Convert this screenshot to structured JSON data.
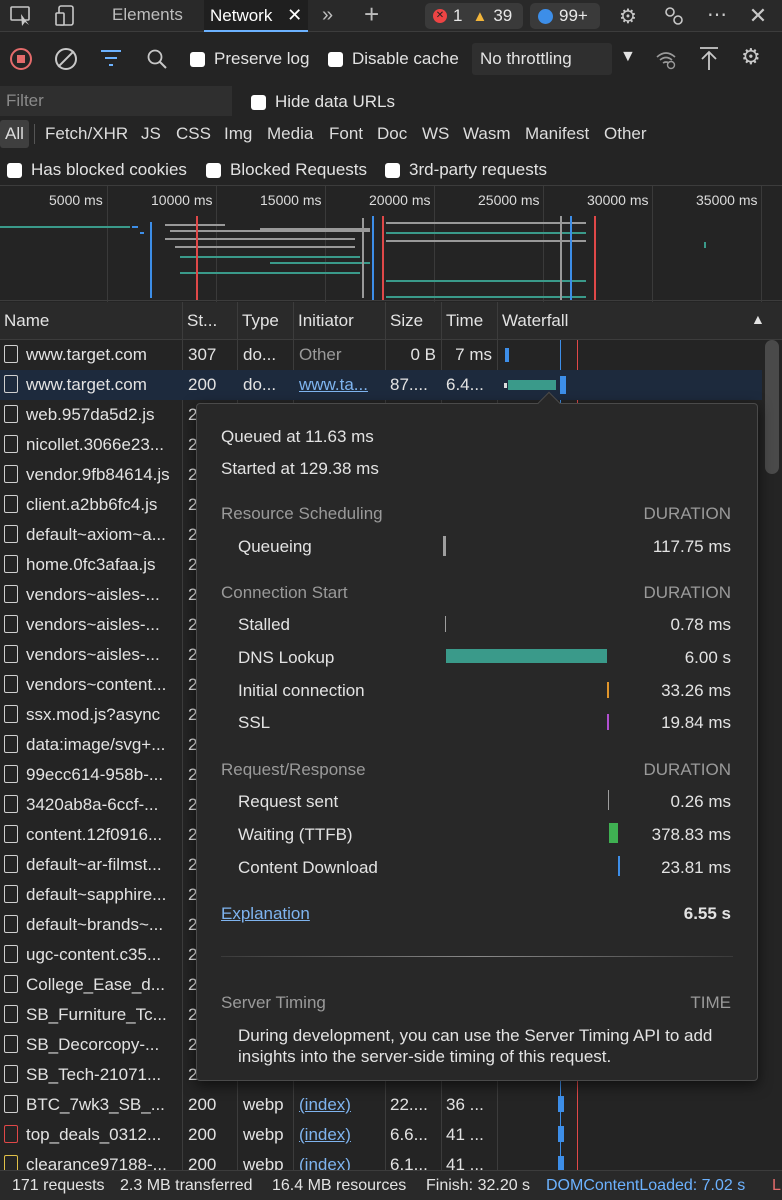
{
  "tabs": {
    "elements": "Elements",
    "network": "Network",
    "errors": "1",
    "warnings": "39",
    "messages": "99+"
  },
  "toolbar": {
    "preserve_log": "Preserve log",
    "disable_cache": "Disable cache",
    "throttling": "No throttling"
  },
  "filter": {
    "placeholder": "Filter",
    "hide_data_urls": "Hide data URLs",
    "types": [
      "All",
      "Fetch/XHR",
      "JS",
      "CSS",
      "Img",
      "Media",
      "Font",
      "Doc",
      "WS",
      "Wasm",
      "Manifest",
      "Other"
    ],
    "has_blocked_cookies": "Has blocked cookies",
    "blocked_requests": "Blocked Requests",
    "third_party": "3rd-party requests"
  },
  "overview": {
    "ticks": [
      "5000 ms",
      "10000 ms",
      "15000 ms",
      "20000 ms",
      "25000 ms",
      "30000 ms",
      "35000 ms"
    ]
  },
  "table": {
    "headers": [
      "Name",
      "St...",
      "Type",
      "Initiator",
      "Size",
      "Time",
      "Waterfall"
    ],
    "rows": [
      {
        "name": "www.target.com",
        "status": "307",
        "type": "do...",
        "initiator": "Other",
        "size": "0 B",
        "time": "7 ms"
      },
      {
        "name": "www.target.com",
        "status": "200",
        "type": "do...",
        "initiator": "www.ta...",
        "size": "87....",
        "time": "6.4..."
      },
      {
        "name": "web.957da5d2.js",
        "status": "2"
      },
      {
        "name": "nicollet.3066e23...",
        "status": "2"
      },
      {
        "name": "vendor.9fb84614.js",
        "status": "2"
      },
      {
        "name": "client.a2bb6fc4.js",
        "status": "2"
      },
      {
        "name": "default~axiom~a...",
        "status": "2"
      },
      {
        "name": "home.0fc3afaa.js",
        "status": "2"
      },
      {
        "name": "vendors~aisles-...",
        "status": "2"
      },
      {
        "name": "vendors~aisles-...",
        "status": "2"
      },
      {
        "name": "vendors~aisles-...",
        "status": "2"
      },
      {
        "name": "vendors~content...",
        "status": "2"
      },
      {
        "name": "ssx.mod.js?async",
        "status": "2"
      },
      {
        "name": "data:image/svg+...",
        "status": "2"
      },
      {
        "name": "99ecc614-958b-...",
        "status": "2"
      },
      {
        "name": "3420ab8a-6ccf-...",
        "status": "2"
      },
      {
        "name": "content.12f0916...",
        "status": "2"
      },
      {
        "name": "default~ar-filmst...",
        "status": "2"
      },
      {
        "name": "default~sapphire...",
        "status": "2"
      },
      {
        "name": "default~brands~...",
        "status": "2"
      },
      {
        "name": "ugc-content.c35...",
        "status": "2"
      },
      {
        "name": "College_Ease_d...",
        "status": "2"
      },
      {
        "name": "SB_Furniture_Tc...",
        "status": "2"
      },
      {
        "name": "SB_Decorcopy-...",
        "status": "2"
      },
      {
        "name": "SB_Tech-21071...",
        "status": "2"
      },
      {
        "name": "BTC_7wk3_SB_...",
        "status": "200",
        "type": "webp",
        "initiator": "(index)",
        "size": "22....",
        "time": "36 ..."
      },
      {
        "name": "top_deals_0312...",
        "status": "200",
        "type": "webp",
        "initiator": "(index)",
        "size": "6.6...",
        "time": "41 ..."
      },
      {
        "name": "clearance97188-...",
        "status": "200",
        "type": "webp",
        "initiator": "(index)",
        "size": "6.1...",
        "time": "41 ..."
      }
    ]
  },
  "popover": {
    "queued": "Queued at 11.63 ms",
    "started": "Started at 129.38 ms",
    "sections": {
      "resource_scheduling": "Resource Scheduling",
      "connection_start": "Connection Start",
      "request_response": "Request/Response",
      "duration": "DURATION"
    },
    "phases": [
      {
        "label": "Queueing",
        "duration": "117.75 ms",
        "color": "#9e9e9e"
      },
      {
        "label": "Stalled",
        "duration": "0.78 ms",
        "color": "#9e9e9e"
      },
      {
        "label": "DNS Lookup",
        "duration": "6.00 s",
        "color": "#3a9a8a"
      },
      {
        "label": "Initial connection",
        "duration": "33.26 ms",
        "color": "#e0952b"
      },
      {
        "label": "SSL",
        "duration": "19.84 ms",
        "color": "#b14fd1"
      },
      {
        "label": "Request sent",
        "duration": "0.26 ms",
        "color": "#9e9e9e"
      },
      {
        "label": "Waiting (TTFB)",
        "duration": "378.83 ms",
        "color": "#3fb052"
      },
      {
        "label": "Content Download",
        "duration": "23.81 ms",
        "color": "#3d8ee8"
      }
    ],
    "explanation": "Explanation",
    "total": "6.55 s",
    "server_timing": "Server Timing",
    "time": "TIME",
    "server_timing_text": "During development, you can use the Server Timing API to add insights into the server-side timing of this request."
  },
  "status": {
    "requests": "171 requests",
    "transferred": "2.3 MB transferred",
    "resources": "16.4 MB resources",
    "finish": "Finish: 32.20 s",
    "dcl": "DOMContentLoaded: 7.02 s",
    "load": "L"
  }
}
